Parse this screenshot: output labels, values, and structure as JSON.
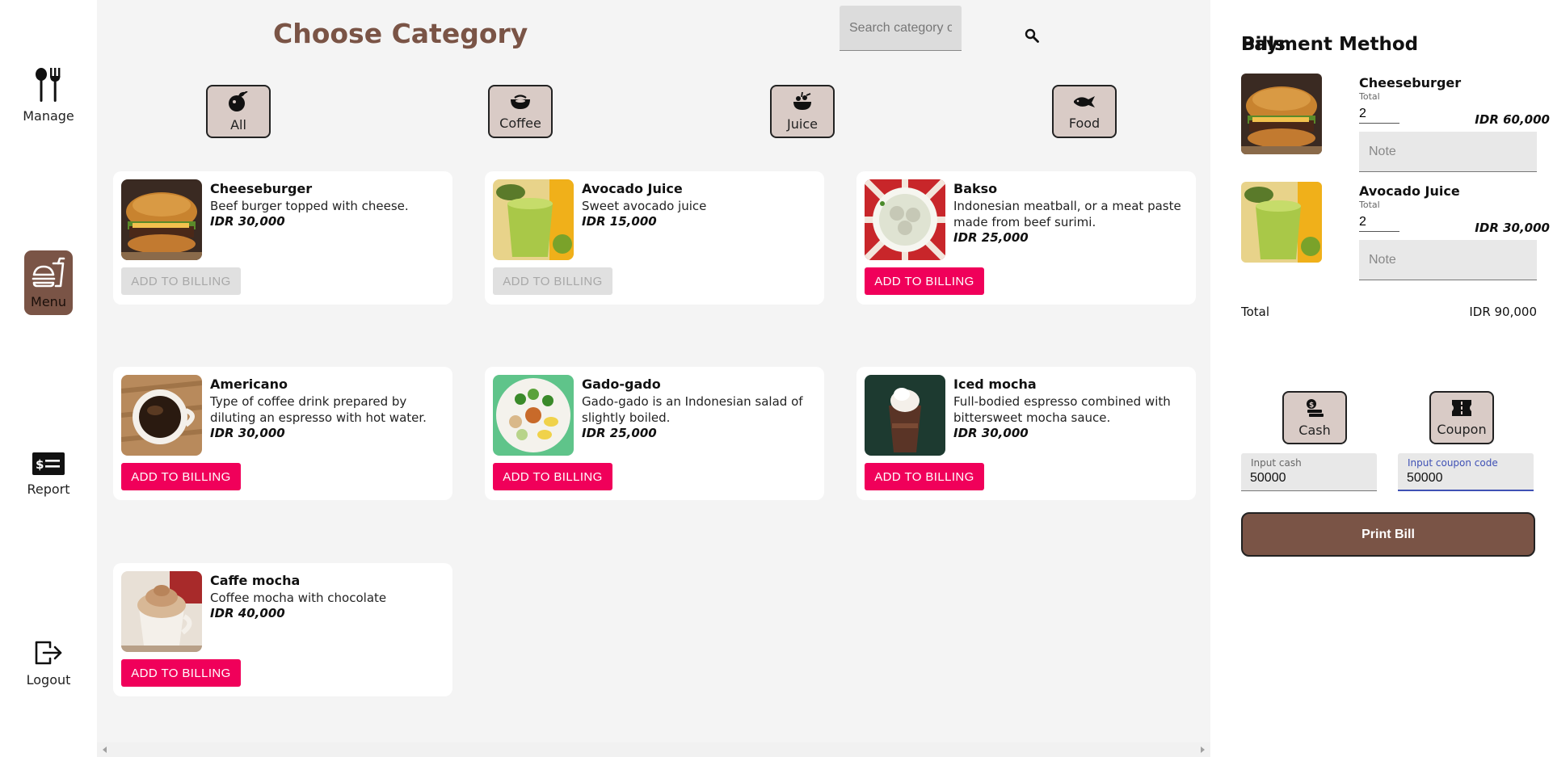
{
  "sidebar": {
    "items": [
      {
        "label": "Manage",
        "icon": "cutlery-icon"
      },
      {
        "label": "Menu",
        "icon": "fastfood-icon",
        "active": true
      },
      {
        "label": "Report",
        "icon": "receipt-icon"
      },
      {
        "label": "Logout",
        "icon": "logout-icon"
      }
    ]
  },
  "header": {
    "title": "Choose Category",
    "search_placeholder": "Search category or menu"
  },
  "categories": [
    {
      "label": "All",
      "icon": "all-icon"
    },
    {
      "label": "Coffee",
      "icon": "coffee-icon"
    },
    {
      "label": "Juice",
      "icon": "juice-icon"
    },
    {
      "label": "Food",
      "icon": "food-icon"
    }
  ],
  "menu": [
    {
      "name": "Cheeseburger",
      "desc": "Beef burger topped with cheese.",
      "price": "IDR 30,000",
      "button": "ADD TO BILLING",
      "disabled": true
    },
    {
      "name": "Avocado Juice",
      "desc": "Sweet avocado juice",
      "price": "IDR 15,000",
      "button": "ADD TO BILLING",
      "disabled": true
    },
    {
      "name": "Bakso",
      "desc": "Indonesian meatball, or a meat paste made from beef surimi.",
      "price": "IDR 25,000",
      "button": "ADD TO BILLING",
      "disabled": false
    },
    {
      "name": "Americano",
      "desc": "Type of coffee drink prepared by diluting an espresso with hot water.",
      "price": "IDR 30,000",
      "button": "ADD TO BILLING",
      "disabled": false
    },
    {
      "name": "Gado-gado",
      "desc": "Gado-gado is an Indonesian salad of slightly boiled.",
      "price": "IDR 25,000",
      "button": "ADD TO BILLING",
      "disabled": false
    },
    {
      "name": "Iced mocha",
      "desc": "Full-bodied espresso combined with bittersweet mocha sauce.",
      "price": "IDR 30,000",
      "button": "ADD TO BILLING",
      "disabled": false
    },
    {
      "name": "Caffe mocha",
      "desc": "Coffee mocha with chocolate",
      "price": "IDR 40,000",
      "button": "ADD TO BILLING",
      "disabled": false
    }
  ],
  "bills": {
    "title": "Bills",
    "items": [
      {
        "name": "Cheeseburger",
        "total_label": "Total",
        "qty": "2",
        "price": "IDR 60,000",
        "note_placeholder": "Note"
      },
      {
        "name": "Avocado Juice",
        "total_label": "Total",
        "qty": "2",
        "price": "IDR 30,000",
        "note_placeholder": "Note"
      }
    ],
    "total_label": "Total",
    "total_value": "IDR 90,000"
  },
  "payment": {
    "title": "Payment Method",
    "methods": [
      {
        "label": "Cash",
        "icon": "cash-icon"
      },
      {
        "label": "Coupon",
        "icon": "coupon-icon"
      }
    ],
    "cash_label": "Input cash",
    "cash_value": "50000",
    "coupon_label": "Input coupon code",
    "coupon_value": "50000",
    "print_label": "Print Bill"
  },
  "colors": {
    "brand": "#7a5446",
    "accent": "#f0005a",
    "category_bg": "#d9cbc6",
    "focus": "#3f51b5"
  }
}
